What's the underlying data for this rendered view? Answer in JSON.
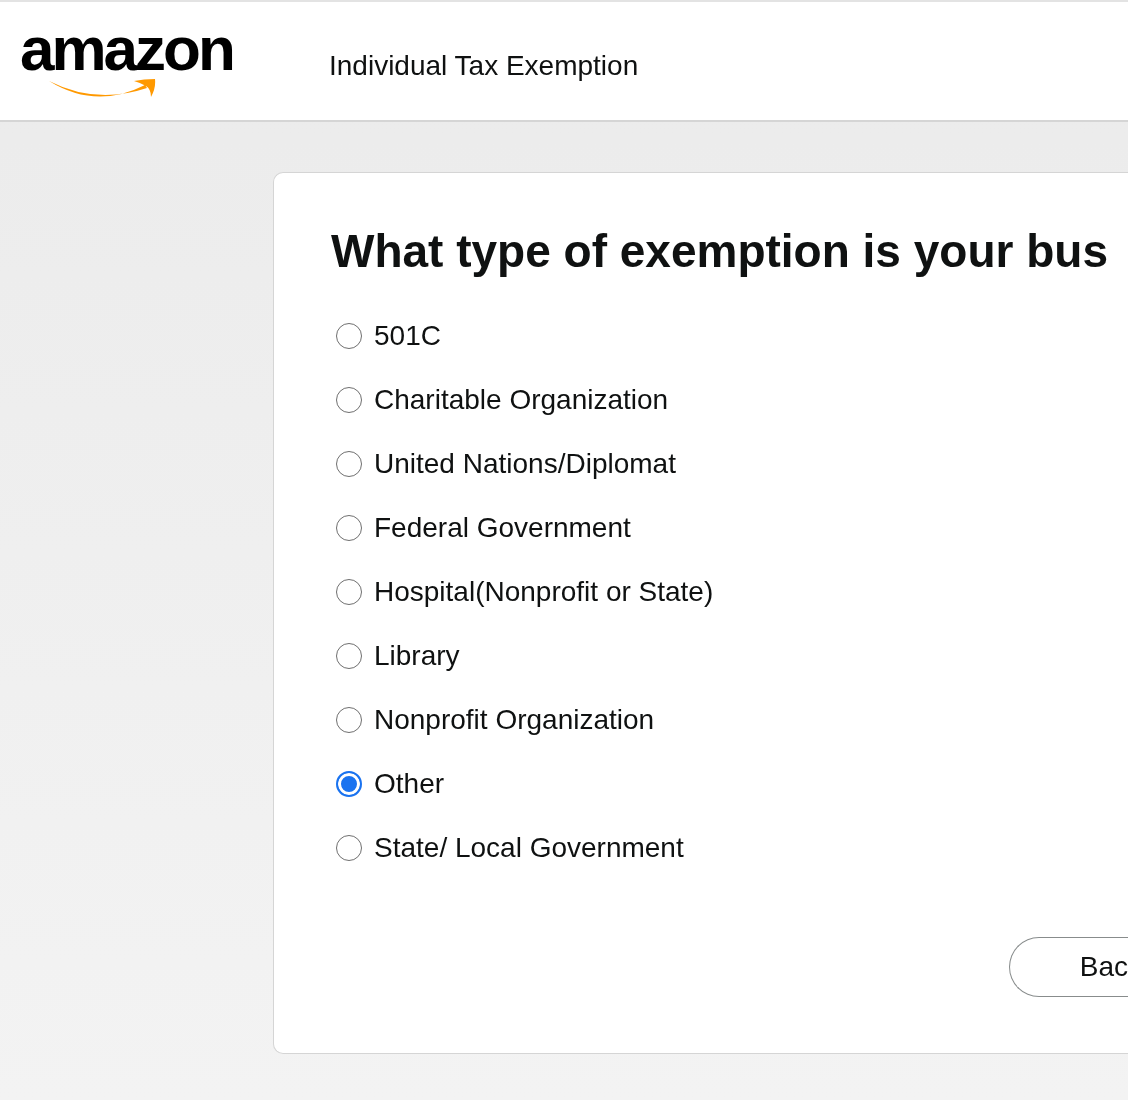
{
  "header": {
    "logo": "amazon",
    "title": "Individual Tax Exemption"
  },
  "question": {
    "heading": "What type of exemption is your bus",
    "options": [
      {
        "label": "501C",
        "selected": false
      },
      {
        "label": "Charitable Organization",
        "selected": false
      },
      {
        "label": "United Nations/Diplomat",
        "selected": false
      },
      {
        "label": "Federal Government",
        "selected": false
      },
      {
        "label": "Hospital(Nonprofit or State)",
        "selected": false
      },
      {
        "label": "Library",
        "selected": false
      },
      {
        "label": "Nonprofit Organization",
        "selected": false
      },
      {
        "label": "Other",
        "selected": true
      },
      {
        "label": "State/ Local Government",
        "selected": false
      }
    ]
  },
  "back_button": {
    "label": "Bac"
  }
}
